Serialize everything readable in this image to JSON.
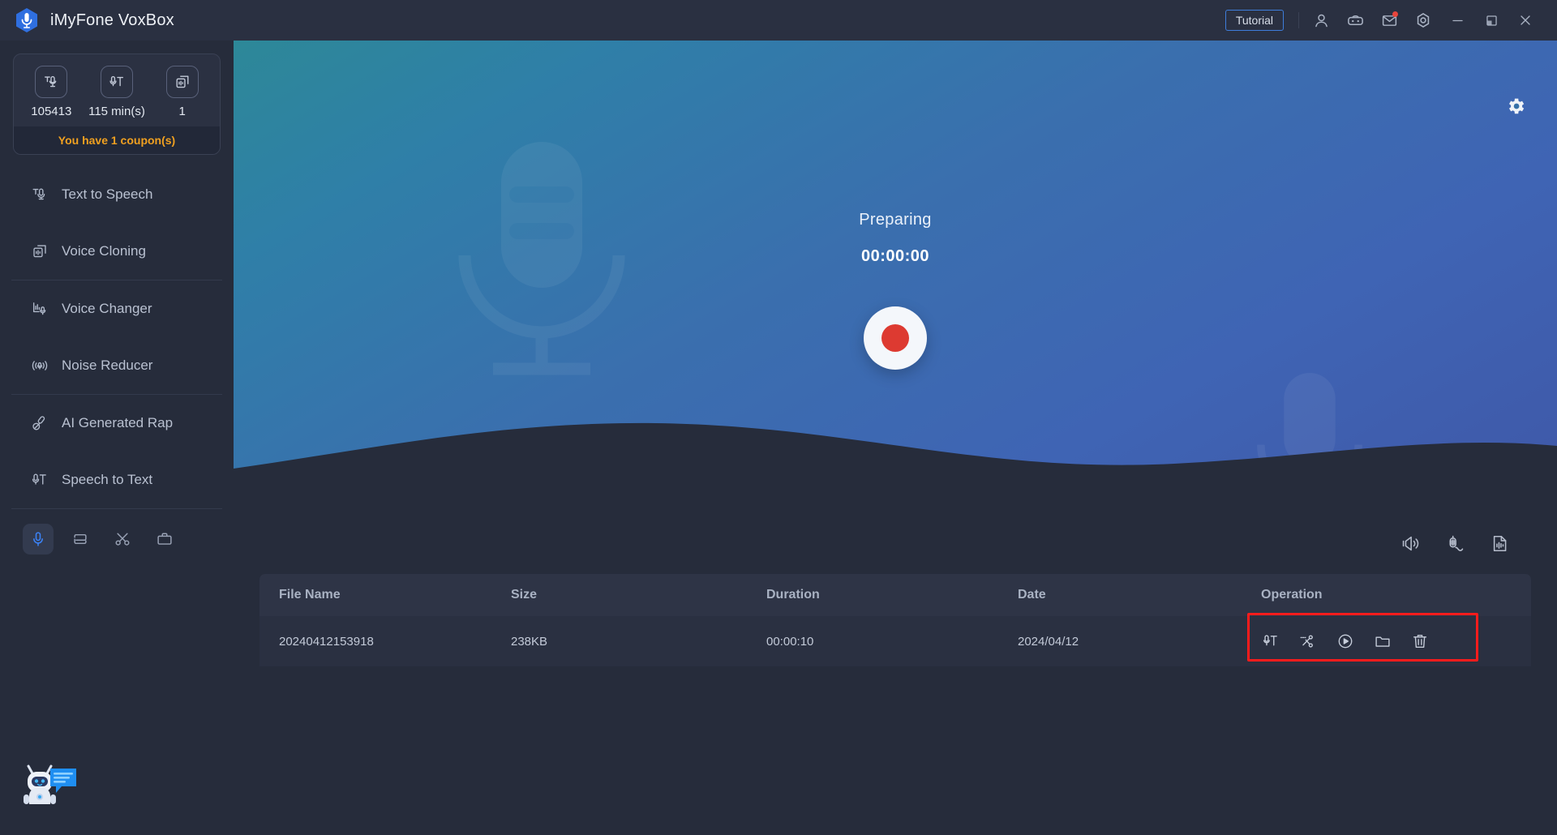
{
  "app": {
    "title": "iMyFone VoxBox",
    "logo_icon": "voxbox-mic-logo"
  },
  "titlebar": {
    "tutorial_label": "Tutorial",
    "icons": [
      {
        "name": "account-icon",
        "label": "Account"
      },
      {
        "name": "discord-icon",
        "label": "Discord"
      },
      {
        "name": "mail-icon",
        "label": "Messages"
      },
      {
        "name": "settings-icon",
        "label": "Settings"
      },
      {
        "name": "minimize-icon",
        "label": "Minimize"
      },
      {
        "name": "maximize-icon",
        "label": "Maximize"
      },
      {
        "name": "close-icon",
        "label": "Close"
      }
    ]
  },
  "sidebar": {
    "stats": [
      {
        "icon": "text-to-speech-icon",
        "value": "105413"
      },
      {
        "icon": "speech-to-text-icon",
        "value": "115 min(s)"
      },
      {
        "icon": "voice-cloning-icon",
        "value": "1"
      }
    ],
    "coupon_text": "You have 1 coupon(s)",
    "items": [
      {
        "label": "Text to Speech",
        "icon": "text-to-speech-icon"
      },
      {
        "label": "Voice Cloning",
        "icon": "voice-cloning-icon"
      },
      {
        "label": "Voice Changer",
        "icon": "voice-changer-icon"
      },
      {
        "label": "Noise Reducer",
        "icon": "noise-reducer-icon"
      },
      {
        "label": "AI Generated Rap",
        "icon": "ai-rap-icon"
      },
      {
        "label": "Speech to Text",
        "icon": "speech-to-text-icon"
      }
    ],
    "dock": [
      {
        "name": "recorder-tool",
        "icon": "microphone-icon",
        "active": true
      },
      {
        "name": "converter-tool",
        "icon": "convert-icon",
        "active": false
      },
      {
        "name": "cutter-tool",
        "icon": "scissors-icon",
        "active": false
      },
      {
        "name": "toolbox-tool",
        "icon": "toolbox-icon",
        "active": false
      }
    ],
    "chatbot_icon": "chatbot-assistant-icon"
  },
  "hero": {
    "settings_icon": "gear-icon",
    "status": "Preparing",
    "time": "00:00:00",
    "record_button_label": "record-button"
  },
  "file_tools": [
    {
      "name": "speaker-icon",
      "label": "System sound"
    },
    {
      "name": "microphone-waveform-icon",
      "label": "Microphone"
    },
    {
      "name": "file-waveform-icon",
      "label": "Audio file"
    }
  ],
  "table": {
    "columns": [
      "File Name",
      "Size",
      "Duration",
      "Date",
      "Operation"
    ],
    "rows": [
      {
        "file_name": "20240412153918",
        "size": "238KB",
        "duration": "00:00:10",
        "date": "2024/04/12",
        "operations": [
          {
            "name": "speech-to-text-icon",
            "label": "Speech to Text"
          },
          {
            "name": "scissors-icon",
            "label": "Cut"
          },
          {
            "name": "play-icon",
            "label": "Play"
          },
          {
            "name": "folder-icon",
            "label": "Open folder"
          },
          {
            "name": "trash-icon",
            "label": "Delete"
          }
        ]
      }
    ]
  },
  "colors": {
    "accent_blue": "#3b82f6",
    "coupon_orange": "#f0a020",
    "record_red": "#dd3a31",
    "highlight_red": "#fb1c1c",
    "sidebar_bg": "#262c3b",
    "titlebar_bg": "#2a3041",
    "hero_gradient_start": "#2d8898",
    "hero_gradient_end": "#3f58a8"
  }
}
